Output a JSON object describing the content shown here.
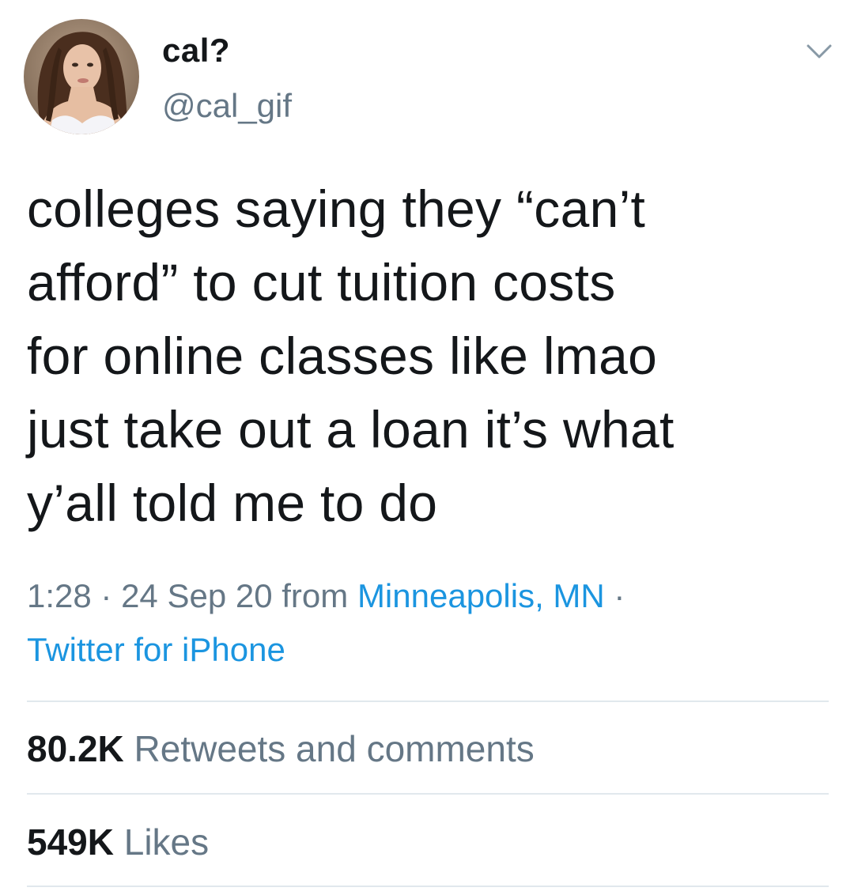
{
  "user": {
    "display_name": "cal?",
    "handle": "@cal_gif",
    "avatar_icon": "profile-photo"
  },
  "tweet": {
    "lines": [
      "colleges saying they “can’t",
      "afford” to cut tuition costs",
      "for online classes like lmao",
      "just take out a loan it’s what",
      "y’all told me to do"
    ]
  },
  "meta": {
    "time": "1:28",
    "separator": " · ",
    "date": "24 Sep 20",
    "from_label": " from ",
    "location": "Minneapolis, MN",
    "separator2": " ·",
    "source": "Twitter for iPhone"
  },
  "stats": {
    "retweets_count": "80.2K",
    "retweets_label": " Retweets and comments",
    "likes_count": "549K",
    "likes_label": " Likes"
  },
  "menu_icon": "chevron-down-icon",
  "colors": {
    "text": "#14171a",
    "secondary": "#657786",
    "link": "#1b95e0",
    "divider": "#e1e8ed"
  }
}
